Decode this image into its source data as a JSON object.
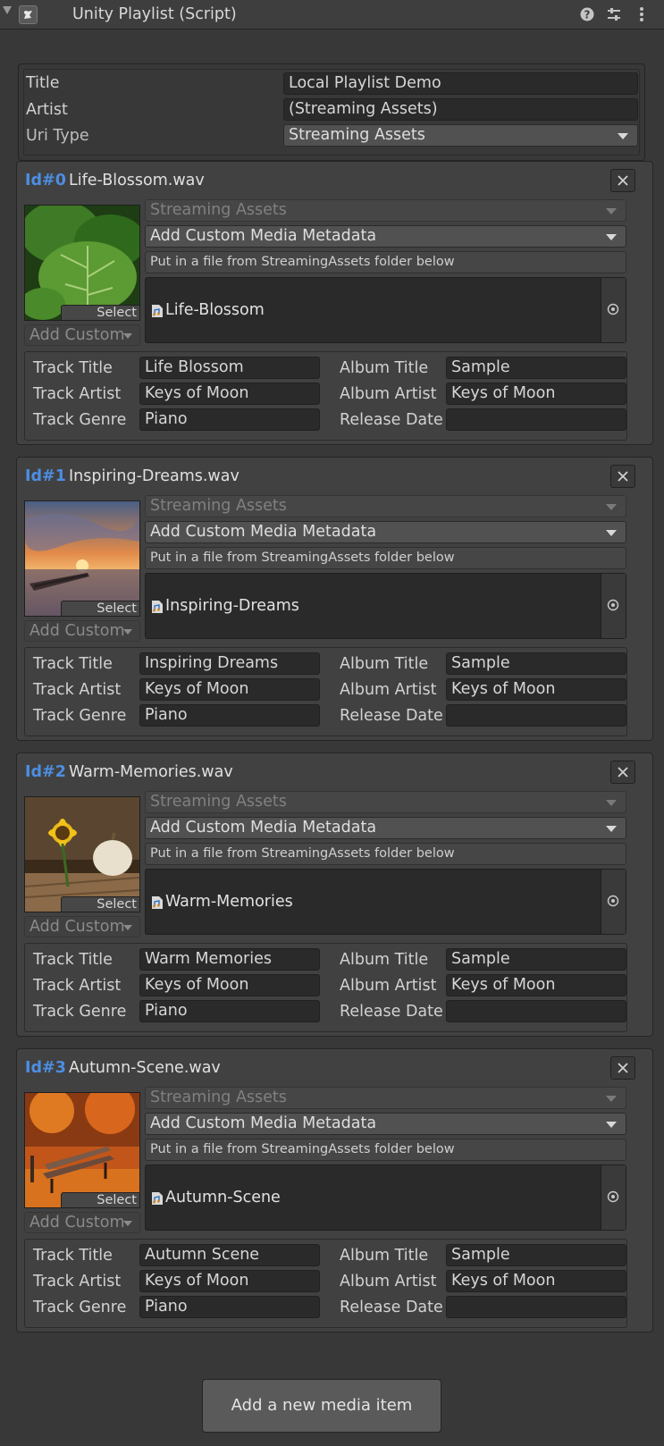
{
  "header": {
    "title": "Unity Playlist (Script)"
  },
  "settings": {
    "title_label": "Title",
    "title_value": "Local Playlist Demo",
    "artist_label": "Artist",
    "artist_value": "(Streaming Assets)",
    "uri_type_label": "Uri Type",
    "uri_type_value": "Streaming Assets"
  },
  "items": [
    {
      "id": "Id#0",
      "file": "Life-Blossom.wav",
      "asset": "Life-Blossom",
      "uri_type": "Streaming Assets",
      "metadata_dropdown": "Add Custom Media Metadata",
      "help": "Put in a file from StreamingAssets folder below",
      "select_label": "Select",
      "add_custom": "Add Custom",
      "track_title_label": "Track Title",
      "track_title": "Life Blossom",
      "track_artist_label": "Track Artist",
      "track_artist": "Keys of Moon",
      "track_genre_label": "Track Genre",
      "track_genre": "Piano",
      "album_title_label": "Album Title",
      "album_title": "Sample",
      "album_artist_label": "Album Artist",
      "album_artist": "Keys of Moon",
      "release_date_label": "Release Date",
      "release_date": ""
    },
    {
      "id": "Id#1",
      "file": "Inspiring-Dreams.wav",
      "asset": "Inspiring-Dreams",
      "uri_type": "Streaming Assets",
      "metadata_dropdown": "Add Custom Media Metadata",
      "help": "Put in a file from StreamingAssets folder below",
      "select_label": "Select",
      "add_custom": "Add Custom",
      "track_title_label": "Track Title",
      "track_title": "Inspiring Dreams",
      "track_artist_label": "Track Artist",
      "track_artist": "Keys of Moon",
      "track_genre_label": "Track Genre",
      "track_genre": "Piano",
      "album_title_label": "Album Title",
      "album_title": "Sample",
      "album_artist_label": "Album Artist",
      "album_artist": "Keys of Moon",
      "release_date_label": "Release Date",
      "release_date": ""
    },
    {
      "id": "Id#2",
      "file": "Warm-Memories.wav",
      "asset": "Warm-Memories",
      "uri_type": "Streaming Assets",
      "metadata_dropdown": "Add Custom Media Metadata",
      "help": "Put in a file from StreamingAssets folder below",
      "select_label": "Select",
      "add_custom": "Add Custom",
      "track_title_label": "Track Title",
      "track_title": "Warm Memories",
      "track_artist_label": "Track Artist",
      "track_artist": "Keys of Moon",
      "track_genre_label": "Track Genre",
      "track_genre": "Piano",
      "album_title_label": "Album Title",
      "album_title": "Sample",
      "album_artist_label": "Album Artist",
      "album_artist": "Keys of Moon",
      "release_date_label": "Release Date",
      "release_date": ""
    },
    {
      "id": "Id#3",
      "file": "Autumn-Scene.wav",
      "asset": "Autumn-Scene",
      "uri_type": "Streaming Assets",
      "metadata_dropdown": "Add Custom Media Metadata",
      "help": "Put in a file from StreamingAssets folder below",
      "select_label": "Select",
      "add_custom": "Add Custom",
      "track_title_label": "Track Title",
      "track_title": "Autumn Scene",
      "track_artist_label": "Track Artist",
      "track_artist": "Keys of Moon",
      "track_genre_label": "Track Genre",
      "track_genre": "Piano",
      "album_title_label": "Album Title",
      "album_title": "Sample",
      "album_artist_label": "Album Artist",
      "album_artist": "Keys of Moon",
      "release_date_label": "Release Date",
      "release_date": ""
    }
  ],
  "footer": {
    "add_button": "Add a new media item"
  },
  "colors": {
    "background": "#383838",
    "id_accent": "#4c8ee3"
  },
  "icons": [
    "fold-triangle-icon",
    "script-icon",
    "help-icon",
    "presets-icon",
    "kebab-menu-icon",
    "close-icon",
    "object-picker-icon",
    "audio-file-icon"
  ]
}
